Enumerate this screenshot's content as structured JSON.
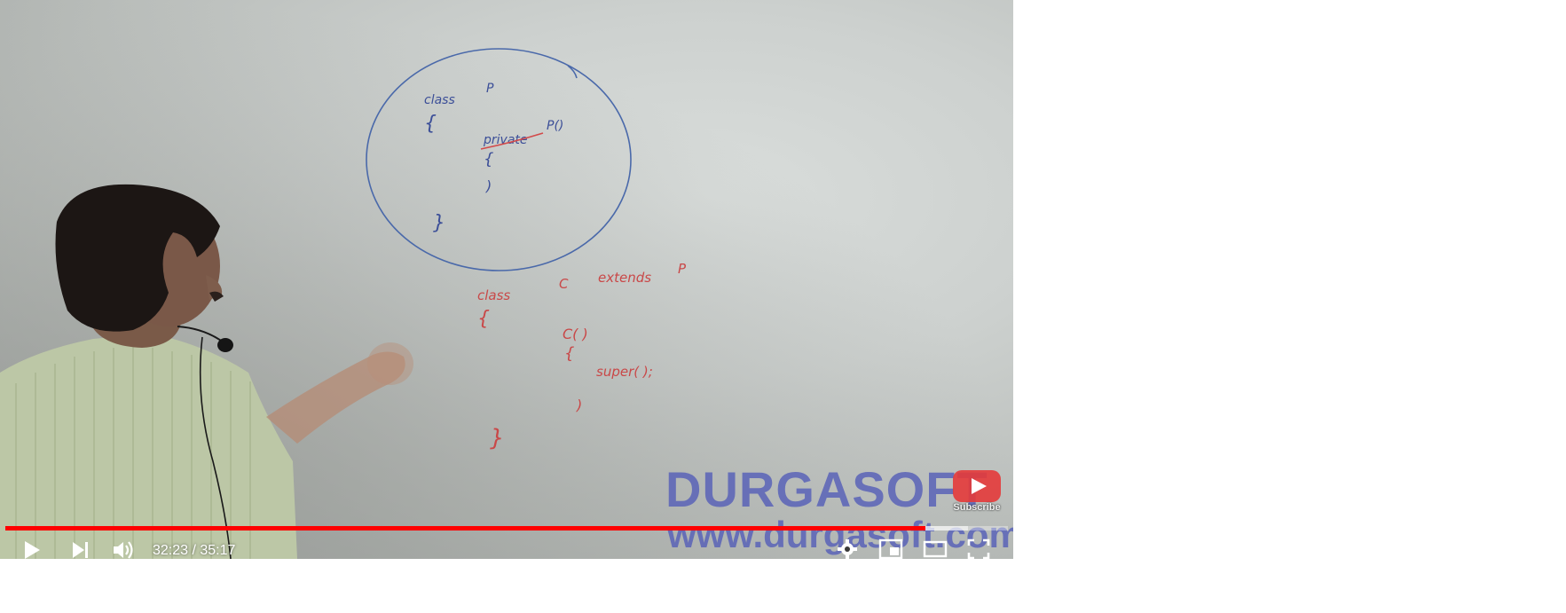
{
  "video": {
    "watermark_title": "DURGASOFT",
    "watermark_url": "www.durgasoft.com",
    "subscribe_label": "Subscribe"
  },
  "player": {
    "current_time": "32:23",
    "duration": "35:17",
    "time_text": "32:23 / 35:17",
    "progress_fraction": 0.918,
    "buffered_fraction": 0.96,
    "accent_color": "#ff0000"
  },
  "controls": {
    "play": "play-icon",
    "next": "next-icon",
    "volume": "volume-icon",
    "settings": "gear-icon",
    "miniplayer": "miniplayer-icon",
    "theater": "theater-icon",
    "fullscreen": "fullscreen-icon"
  },
  "whiteboard": {
    "ink_blue": "#3f5fa8",
    "ink_red": "#d24a4a",
    "lines_blue": [
      "class P",
      "{",
      "private P()",
      "{",
      "}",
      "}"
    ],
    "lines_red": [
      "class C extends P",
      "{",
      "C()",
      "{",
      "super();",
      "}",
      "}"
    ]
  }
}
